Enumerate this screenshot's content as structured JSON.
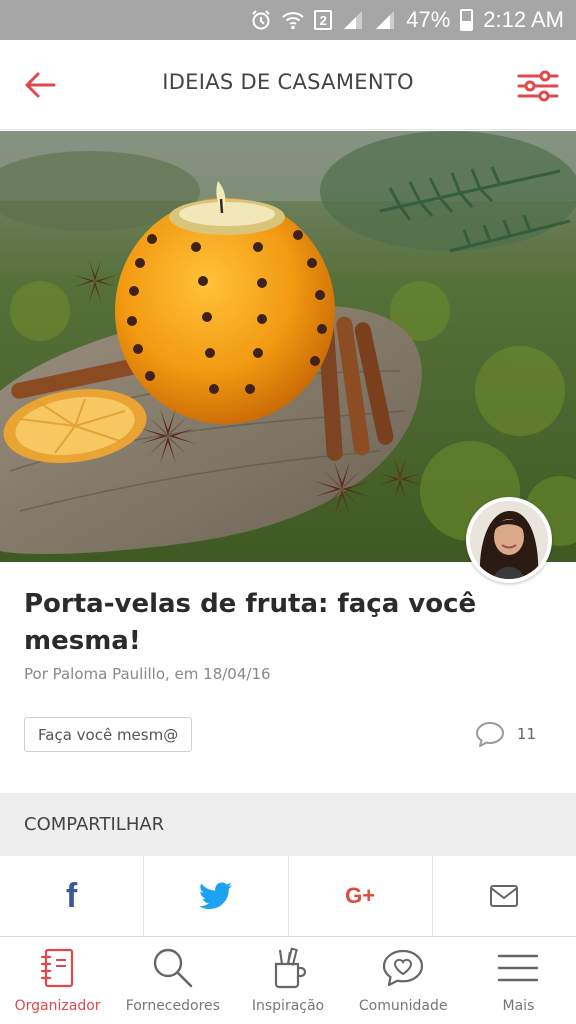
{
  "status_bar": {
    "battery_percent": "47%",
    "sim_slot": "2",
    "time": "2:12 AM",
    "battery_level": 0.47
  },
  "app_bar": {
    "title": "IDEIAS DE CASAMENTO",
    "back_icon": "arrow-left-icon",
    "filter_icon": "sliders-icon"
  },
  "article": {
    "title": "Porta-velas de fruta: faça você mesma!",
    "byline": "Por Paloma Paulillo, em 18/04/16",
    "tag": "Faça você mesm@",
    "comment_count": "11"
  },
  "share": {
    "header": "COMPARTILHAR",
    "buttons": [
      {
        "icon": "facebook-icon",
        "glyph": "f",
        "color": "#3b5998"
      },
      {
        "icon": "twitter-icon",
        "color": "#1da1f2"
      },
      {
        "icon": "google-plus-icon",
        "glyph": "G+",
        "color": "#dd4b39"
      },
      {
        "icon": "email-icon",
        "color": "#666666"
      }
    ]
  },
  "bottom_nav": {
    "items": [
      {
        "label": "Organizador",
        "icon": "notebook-icon",
        "active": true
      },
      {
        "label": "Fornecedores",
        "icon": "search-icon",
        "active": false
      },
      {
        "label": "Inspiração",
        "icon": "pencil-cup-icon",
        "active": false
      },
      {
        "label": "Comunidade",
        "icon": "heart-chat-icon",
        "active": false
      },
      {
        "label": "Mais",
        "icon": "menu-icon",
        "active": false
      }
    ]
  },
  "colors": {
    "accent": "#e0484a",
    "status_bar": "#a6a6a6",
    "share_bg": "#eeeeee"
  }
}
